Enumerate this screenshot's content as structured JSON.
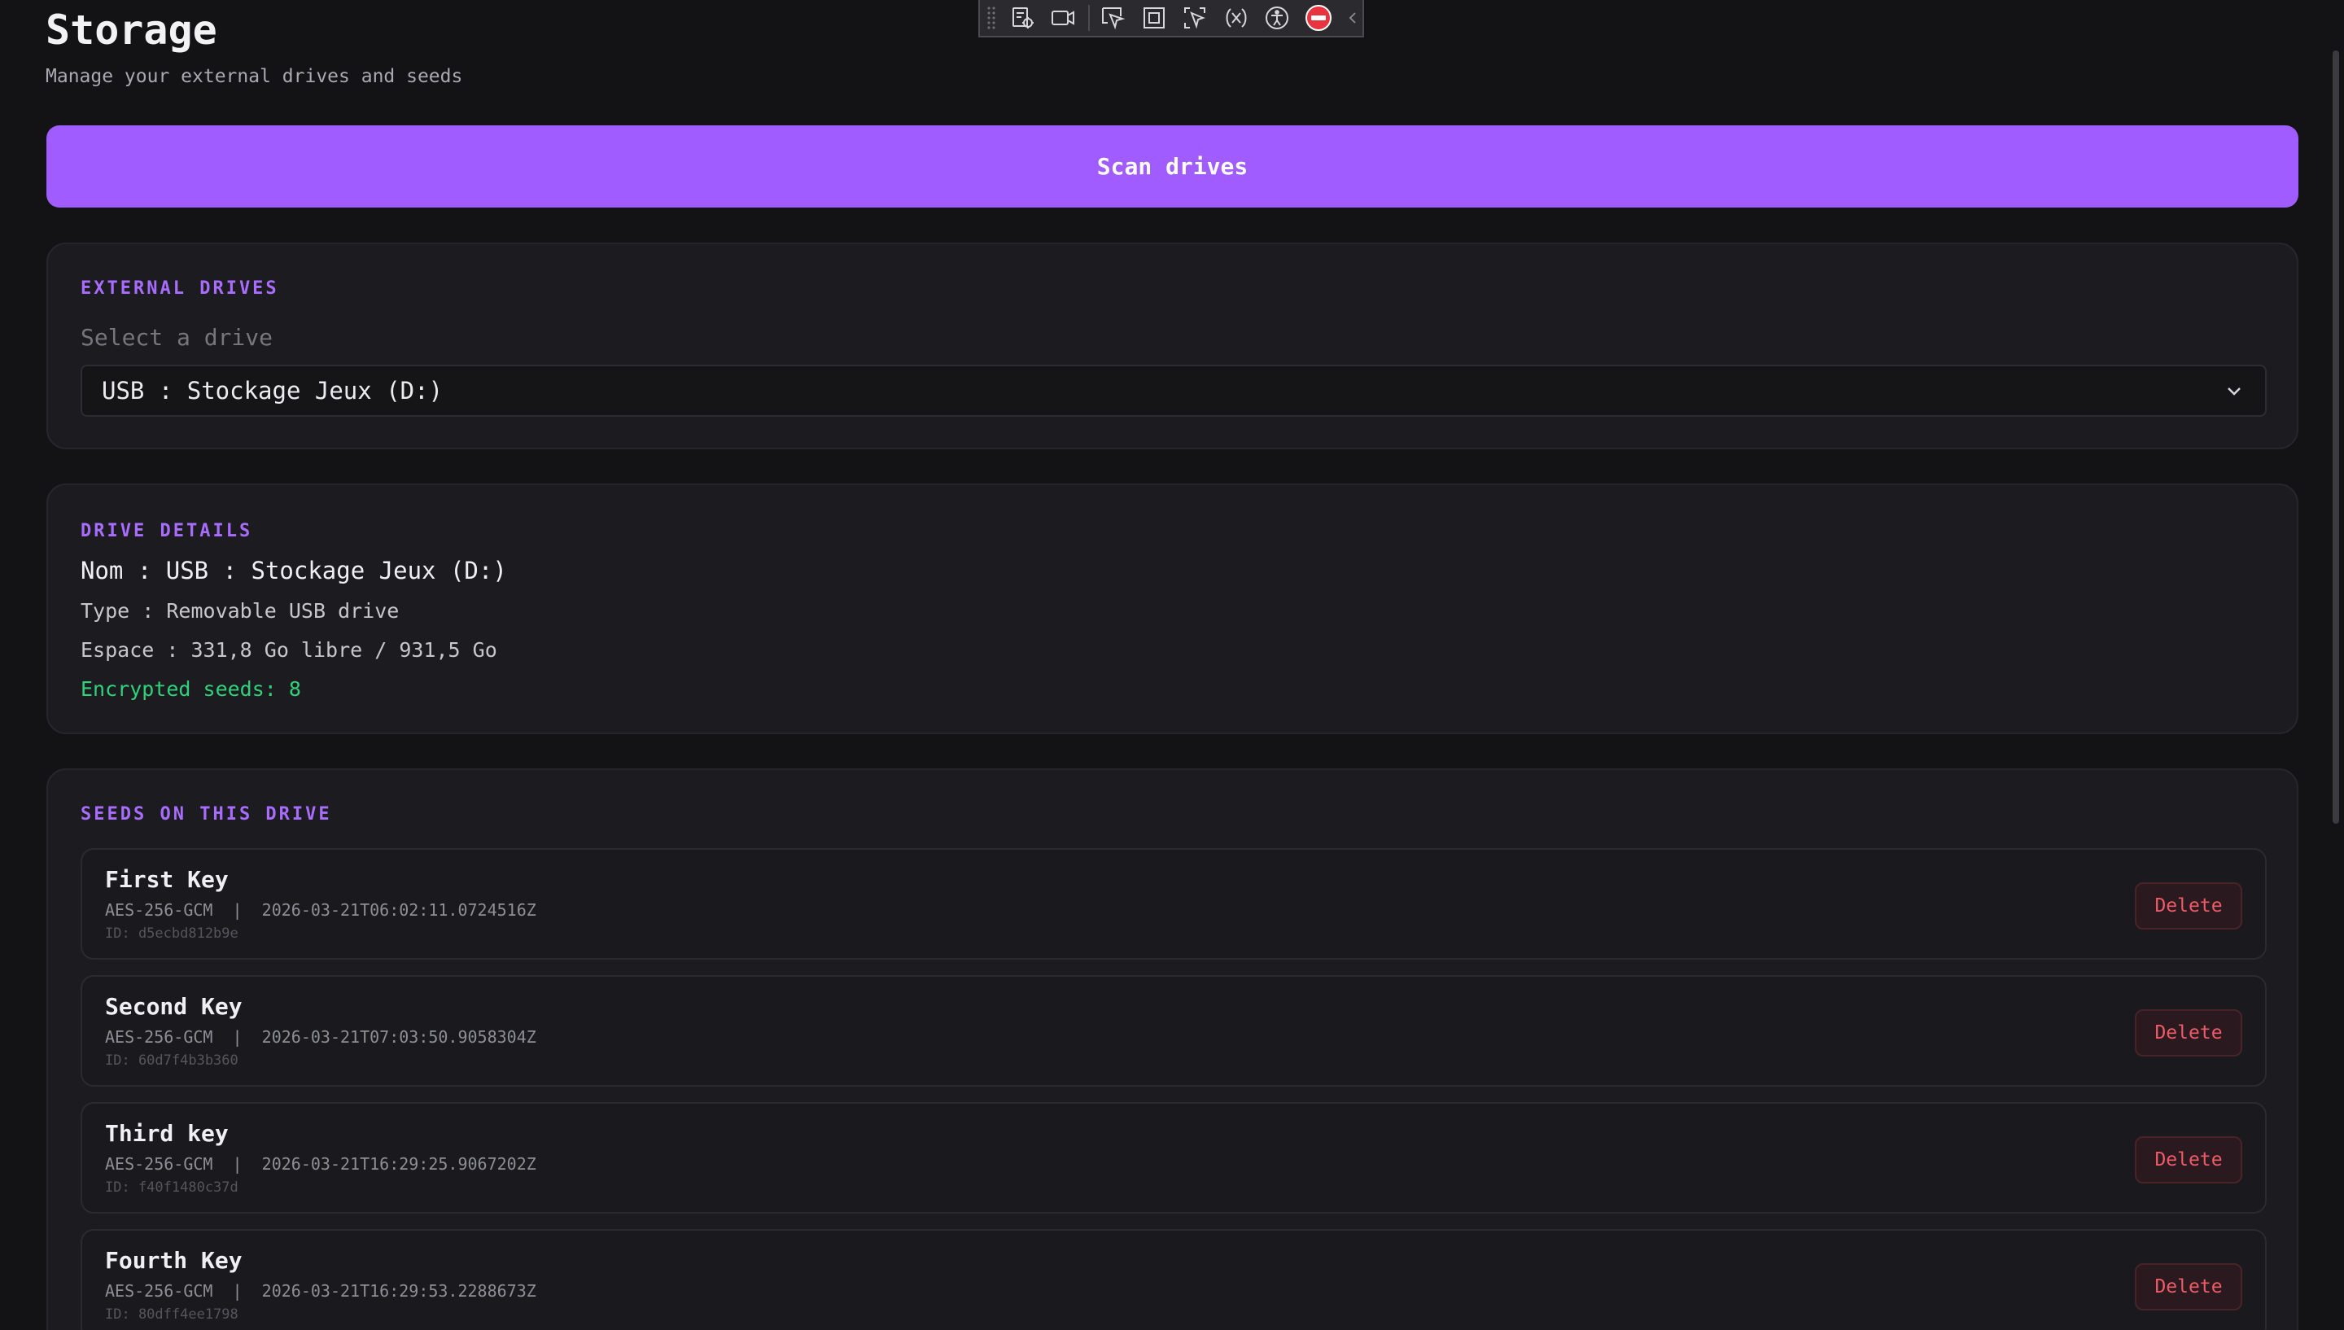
{
  "header": {
    "title": "Storage",
    "subtitle": "Manage your external drives and seeds"
  },
  "devtools": {
    "tools": [
      "inspect-settings-icon",
      "record-icon",
      "select-element-icon",
      "frame-icon",
      "screenshot-select-icon",
      "wave-icon",
      "accessibility-icon",
      "stop-icon",
      "collapse-chevron-icon"
    ]
  },
  "actions": {
    "scan_label": "Scan drives"
  },
  "drives": {
    "section_label": "EXTERNAL DRIVES",
    "select_hint": "Select a drive",
    "selected_value": "USB : Stockage Jeux (D:)"
  },
  "details": {
    "section_label": "DRIVE DETAILS",
    "name": "Nom : USB : Stockage Jeux (D:)",
    "type": "Type : Removable USB drive",
    "space": "Espace : 331,8 Go libre / 931,5 Go",
    "encrypted": "Encrypted seeds: 8"
  },
  "seeds": {
    "section_label": "SEEDS ON THIS DRIVE",
    "delete_label": "Delete",
    "items": [
      {
        "name": "First Key",
        "meta": "AES-256-GCM  |  2026-03-21T06:02:11.0724516Z",
        "id": "ID: d5ecbd812b9e"
      },
      {
        "name": "Second Key",
        "meta": "AES-256-GCM  |  2026-03-21T07:03:50.9058304Z",
        "id": "ID: 60d7f4b3b360"
      },
      {
        "name": "Third key",
        "meta": "AES-256-GCM  |  2026-03-21T16:29:25.9067202Z",
        "id": "ID: f40f1480c37d"
      },
      {
        "name": "Fourth Key",
        "meta": "AES-256-GCM  |  2026-03-21T16:29:53.2288673Z",
        "id": "ID: 80dff4ee1798"
      }
    ]
  },
  "colors": {
    "accent": "#a15cff",
    "section_label": "#a86cff",
    "success": "#2fd27a",
    "danger": "#ef5b66",
    "background": "#131316",
    "card": "#1c1c20"
  }
}
